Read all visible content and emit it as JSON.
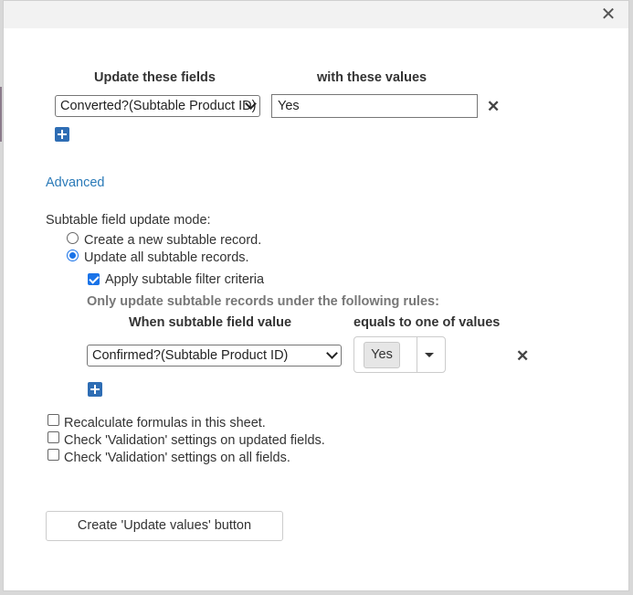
{
  "dialog": {
    "close_icon": "close-icon",
    "close_glyph": "✕"
  },
  "update_section": {
    "fields_header": "Update these fields",
    "values_header": "with these values",
    "field_select": "Converted?(Subtable Product ID)",
    "value_input": "Yes",
    "delete_glyph": "✕"
  },
  "advanced_link": "Advanced",
  "mode": {
    "label": "Subtable field update mode:",
    "options": [
      {
        "label": "Create a new subtable record.",
        "selected": false
      },
      {
        "label": "Update all subtable records.",
        "selected": true
      }
    ],
    "apply_filter_label": "Apply subtable filter criteria",
    "apply_filter_checked": true,
    "rules_caption": "Only update subtable records under the following rules:"
  },
  "filter_section": {
    "field_header": "When subtable field value",
    "values_header": "equals to one of values",
    "field_select": "Confirmed?(Subtable Product ID)",
    "selected_value": "Yes",
    "delete_glyph": "✕"
  },
  "options": [
    {
      "label": "Recalculate formulas in this sheet.",
      "checked": false
    },
    {
      "label": "Check 'Validation' settings on updated fields.",
      "checked": false
    },
    {
      "label": "Check 'Validation' settings on all fields.",
      "checked": false
    }
  ],
  "create_button": "Create 'Update values' button"
}
